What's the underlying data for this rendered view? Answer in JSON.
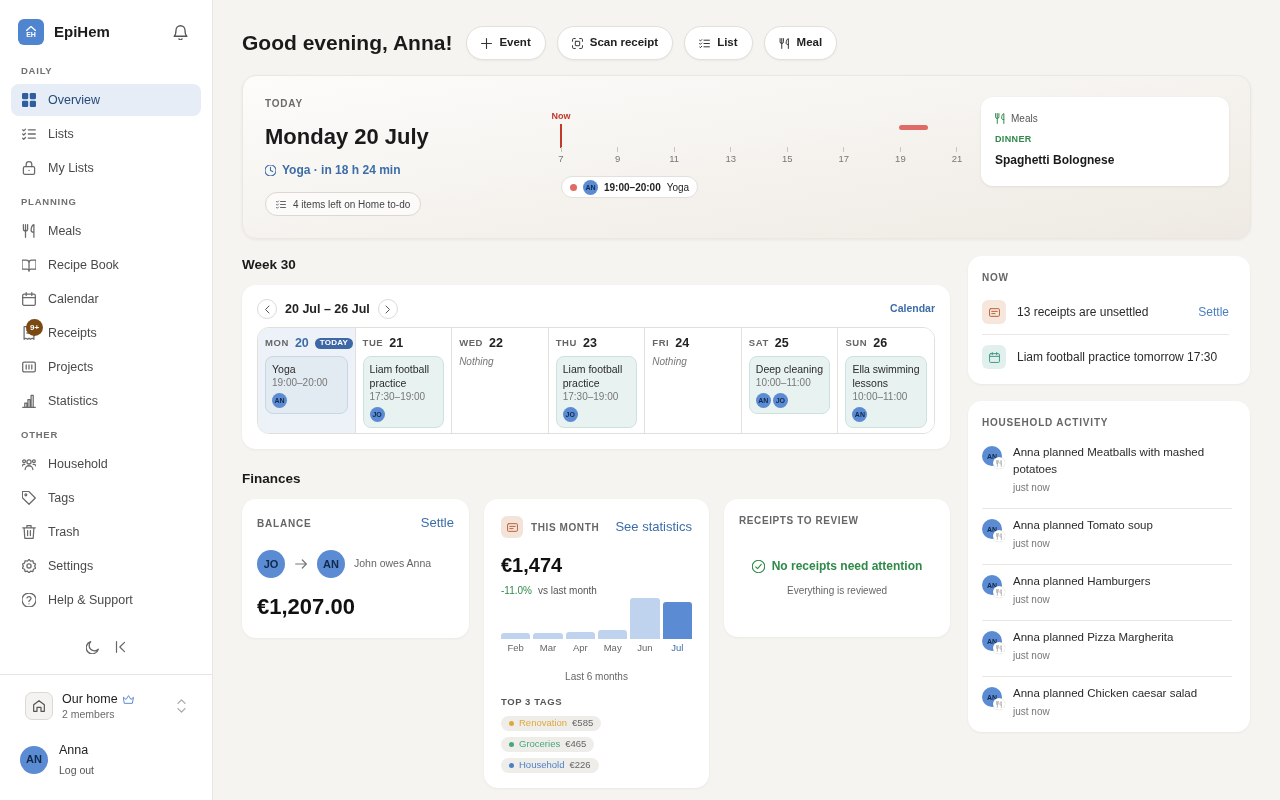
{
  "sidebar": {
    "logo": {
      "initials": "EH",
      "name": "EpiHem"
    },
    "sections": [
      {
        "title": "DAILY",
        "items": [
          {
            "label": "Overview",
            "selected": true
          },
          {
            "label": "Lists",
            "selected": false
          },
          {
            "label": "My Lists",
            "selected": false
          }
        ]
      },
      {
        "title": "PLANNING",
        "items": [
          {
            "label": "Meals",
            "selected": false
          },
          {
            "label": "Recipe Book",
            "selected": false
          },
          {
            "label": "Calendar",
            "selected": false
          },
          {
            "label": "Receipts",
            "selected": false,
            "badge": "9+"
          },
          {
            "label": "Projects",
            "selected": false
          },
          {
            "label": "Statistics",
            "selected": false
          }
        ]
      },
      {
        "title": "OTHER",
        "items": [
          {
            "label": "Household",
            "selected": false
          },
          {
            "label": "Tags",
            "selected": false
          },
          {
            "label": "Trash",
            "selected": false
          },
          {
            "label": "Settings",
            "selected": false
          },
          {
            "label": "Help & Support",
            "selected": false
          }
        ]
      }
    ],
    "household": {
      "name": "Our home",
      "members": "2 members"
    },
    "user": {
      "initials": "AN",
      "name": "Anna",
      "action": "Log out"
    }
  },
  "header": {
    "greeting": "Good evening, Anna!",
    "actions": [
      "Event",
      "Scan receipt",
      "List",
      "Meal"
    ]
  },
  "today": {
    "label": "TODAY",
    "date": "Monday 20 July",
    "next_event": "Yoga · in 18 h 24 min",
    "todo": "4 items left on Home to-do",
    "timeline": {
      "now_label": "Now",
      "hours": [
        "7",
        "9",
        "11",
        "13",
        "15",
        "17",
        "19",
        "21"
      ],
      "event": {
        "initials": "AN",
        "time": "19:00–20:00",
        "title": "Yoga"
      }
    },
    "meals": {
      "title": "Meals",
      "meal_type": "DINNER",
      "dish": "Spaghetti Bolognese"
    }
  },
  "week": {
    "title": "Week 30",
    "range": "20 Jul – 26 Jul",
    "calendar_link": "Calendar",
    "days": [
      {
        "weekday": "MON",
        "date": "20",
        "today_badge": "TODAY",
        "selected": true,
        "events": [
          {
            "title": "Yoga",
            "time": "19:00–20:00",
            "people": [
              "AN"
            ]
          }
        ]
      },
      {
        "weekday": "TUE",
        "date": "21",
        "selected": false,
        "events": [
          {
            "title": "Liam football practice",
            "time": "17:30–19:00",
            "people": [
              "JO"
            ]
          }
        ]
      },
      {
        "weekday": "WED",
        "date": "22",
        "selected": false,
        "empty_text": "Nothing"
      },
      {
        "weekday": "THU",
        "date": "23",
        "selected": false,
        "events": [
          {
            "title": "Liam football practice",
            "time": "17:30–19:00",
            "people": [
              "JO"
            ]
          }
        ]
      },
      {
        "weekday": "FRI",
        "date": "24",
        "selected": false,
        "empty_text": "Nothing"
      },
      {
        "weekday": "SAT",
        "date": "25",
        "selected": false,
        "events": [
          {
            "title": "Deep cleaning",
            "time": "10:00–11:00",
            "people": [
              "AN",
              "JO"
            ]
          }
        ]
      },
      {
        "weekday": "SUN",
        "date": "26",
        "selected": false,
        "events": [
          {
            "title": "Ella swimming lessons",
            "time": "10:00–11:00",
            "people": [
              "AN"
            ]
          }
        ]
      }
    ]
  },
  "finances": {
    "title": "Finances",
    "balance": {
      "label": "BALANCE",
      "action": "Settle",
      "from": "JO",
      "to": "AN",
      "description": "John owes Anna",
      "amount": "€1,207.00"
    },
    "month": {
      "label": "THIS MONTH",
      "action": "See statistics",
      "amount": "€1,474",
      "change": "-11.0%",
      "change_text": "vs last month",
      "months": [
        {
          "label": "Feb",
          "selected": false
        },
        {
          "label": "Mar",
          "selected": false
        },
        {
          "label": "Apr",
          "selected": false
        },
        {
          "label": "May",
          "selected": false
        },
        {
          "label": "Jun",
          "selected": false
        },
        {
          "label": "Jul",
          "selected": true
        }
      ],
      "caption": "Last 6 months",
      "tags_title": "TOP 3 TAGS",
      "tags": [
        {
          "name": "Renovation",
          "amount": "€585",
          "color": "#dcaa3c"
        },
        {
          "name": "Groceries",
          "amount": "€465",
          "color": "#45a878"
        },
        {
          "name": "Household",
          "amount": "€226",
          "color": "#4f80c6"
        }
      ]
    },
    "receipts": {
      "label": "RECEIPTS TO REVIEW",
      "status": "No receipts need attention",
      "detail": "Everything is reviewed"
    }
  },
  "now": {
    "title": "NOW",
    "items": [
      {
        "kind": "receipts",
        "text": "13 receipts are unsettled",
        "action": "Settle"
      },
      {
        "kind": "calendar",
        "text": "Liam football practice tomorrow 17:30"
      }
    ]
  },
  "activity": {
    "title": "HOUSEHOLD ACTIVITY",
    "items": [
      {
        "initials": "AN",
        "text": "Anna planned Meatballs with mashed potatoes",
        "time": "just now"
      },
      {
        "initials": "AN",
        "text": "Anna planned Tomato soup",
        "time": "just now"
      },
      {
        "initials": "AN",
        "text": "Anna planned Hamburgers",
        "time": "just now"
      },
      {
        "initials": "AN",
        "text": "Anna planned Pizza Margherita",
        "time": "just now"
      },
      {
        "initials": "AN",
        "text": "Anna planned Chicken caesar salad",
        "time": "just now"
      }
    ]
  }
}
